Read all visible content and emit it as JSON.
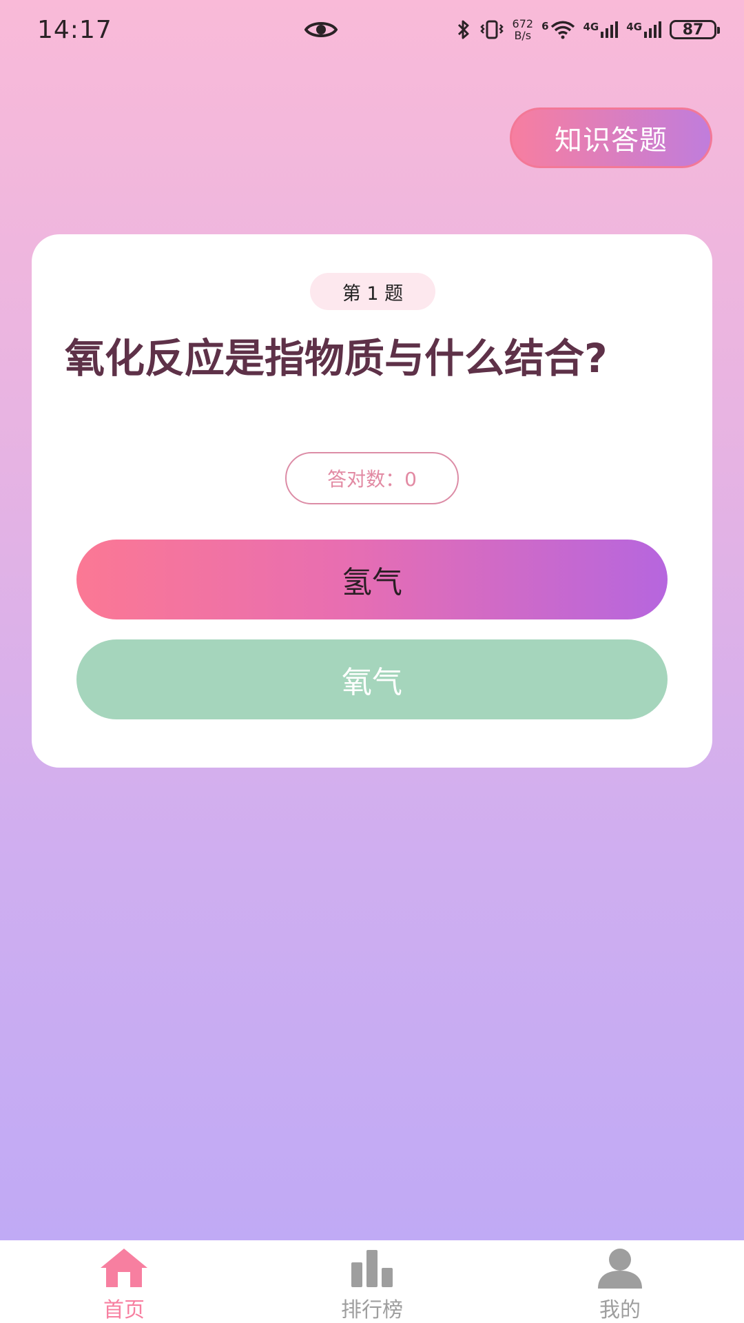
{
  "status_bar": {
    "time": "14:17",
    "net_speed_value": "672",
    "net_speed_unit": "B/s",
    "wifi_badge": "6",
    "signal_1_label": "4G",
    "signal_2_label": "4G",
    "battery_level": "87"
  },
  "header": {
    "quiz_button_label": "知识答题"
  },
  "quiz": {
    "question_number_label": "第 1 题",
    "question_text": "氧化反应是指物质与什么结合?",
    "score_label": "答对数：0",
    "options": [
      {
        "label": "氢气"
      },
      {
        "label": "氧气"
      }
    ]
  },
  "bottom_nav": {
    "items": [
      {
        "label": "首页",
        "icon": "home-icon",
        "active": true
      },
      {
        "label": "排行榜",
        "icon": "bar-chart-icon",
        "active": false
      },
      {
        "label": "我的",
        "icon": "user-icon",
        "active": false
      }
    ]
  },
  "colors": {
    "accent_pink": "#f77fa0",
    "accent_purple": "#b666de",
    "option_green": "#a5d5bc",
    "question_text": "#5e3148",
    "inactive_nav": "#9e9e9e"
  }
}
